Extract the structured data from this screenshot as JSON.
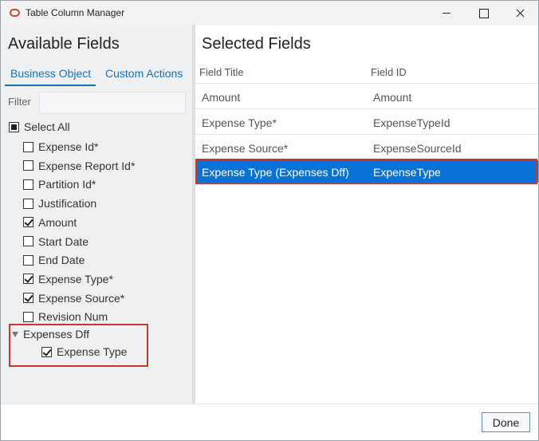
{
  "window": {
    "title": "Table Column Manager"
  },
  "left": {
    "title": "Available Fields",
    "tabs": [
      "Business Object",
      "Custom Actions"
    ],
    "filter_label": "Filter",
    "filter_value": "",
    "select_all": "Select All",
    "fields": [
      {
        "label": "Expense Id*",
        "checked": false
      },
      {
        "label": "Expense Report Id*",
        "checked": false
      },
      {
        "label": "Partition Id*",
        "checked": false
      },
      {
        "label": "Justification",
        "checked": false
      },
      {
        "label": "Amount",
        "checked": true
      },
      {
        "label": "Start Date",
        "checked": false
      },
      {
        "label": "End Date",
        "checked": false
      },
      {
        "label": "Expense Type*",
        "checked": true
      },
      {
        "label": "Expense Source*",
        "checked": true
      },
      {
        "label": "Revision Num",
        "checked": false
      }
    ],
    "group": {
      "label": "Expenses Dff",
      "child_label": "Expense Type",
      "child_checked": true
    }
  },
  "right": {
    "title": "Selected Fields",
    "columns": [
      "Field Title",
      "Field ID"
    ],
    "rows": [
      {
        "title": "Amount",
        "id": "Amount"
      },
      {
        "title": "Expense Type*",
        "id": "ExpenseTypeId"
      },
      {
        "title": "Expense Source*",
        "id": "ExpenseSourceId"
      },
      {
        "title": "Expense Type (Expenses Dff)",
        "id": "ExpenseType",
        "selected": true
      }
    ]
  },
  "footer": {
    "done_label": "Done"
  },
  "colors": {
    "accent": "#0a72d4",
    "highlight": "#c8372d",
    "brand": "#c74634"
  }
}
